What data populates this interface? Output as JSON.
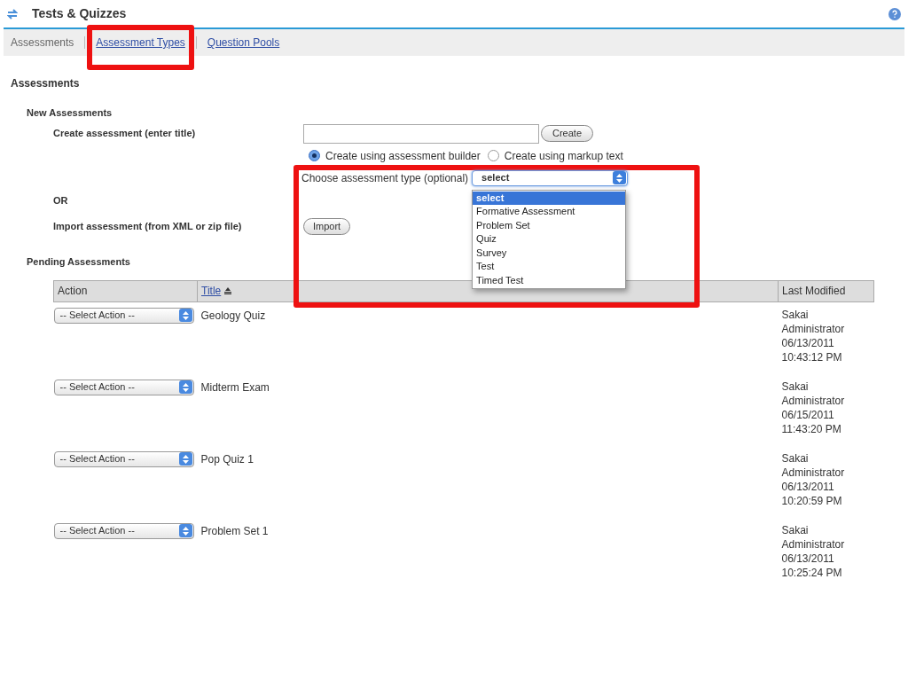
{
  "header": {
    "title": "Tests & Quizzes"
  },
  "nav": [
    {
      "label": "Assessments",
      "selected": true
    },
    {
      "label": "Assessment Types",
      "selected": false
    },
    {
      "label": "Question Pools",
      "selected": false
    }
  ],
  "section_title": "Assessments",
  "new_assessments": {
    "heading": "New Assessments",
    "create_label": "Create assessment (enter title)",
    "create_button": "Create",
    "modes": [
      {
        "label": "Create using assessment builder",
        "selected": true
      },
      {
        "label": "Create using markup text",
        "selected": false
      }
    ],
    "type_label": "Choose assessment type (optional)",
    "type_value": "select",
    "type_options": [
      {
        "label": "select",
        "selected": true
      },
      {
        "label": "Formative Assessment",
        "selected": false
      },
      {
        "label": "Problem Set",
        "selected": false
      },
      {
        "label": "Quiz",
        "selected": false
      },
      {
        "label": "Survey",
        "selected": false
      },
      {
        "label": "Test",
        "selected": false
      },
      {
        "label": "Timed Test",
        "selected": false
      }
    ],
    "or": "OR",
    "import_label": "Import assessment (from XML or zip file)",
    "import_button": "Import"
  },
  "pending": {
    "heading": "Pending Assessments",
    "columns": [
      "Action",
      "Title",
      "Last Modified"
    ],
    "rows": [
      {
        "action": "-- Select Action --",
        "title": "Geology Quiz",
        "modified": "Sakai Administrator 06/13/2011 10:43:12 PM"
      },
      {
        "action": "-- Select Action --",
        "title": "Midterm Exam",
        "modified": "Sakai Administrator 06/15/2011 11:43:20 PM"
      },
      {
        "action": "-- Select Action --",
        "title": "Pop Quiz 1",
        "modified": "Sakai Administrator 06/13/2011 10:20:59 PM"
      },
      {
        "action": "-- Select Action --",
        "title": "Problem Set 1",
        "modified": "Sakai Administrator 06/13/2011 10:25:24 PM"
      }
    ]
  }
}
